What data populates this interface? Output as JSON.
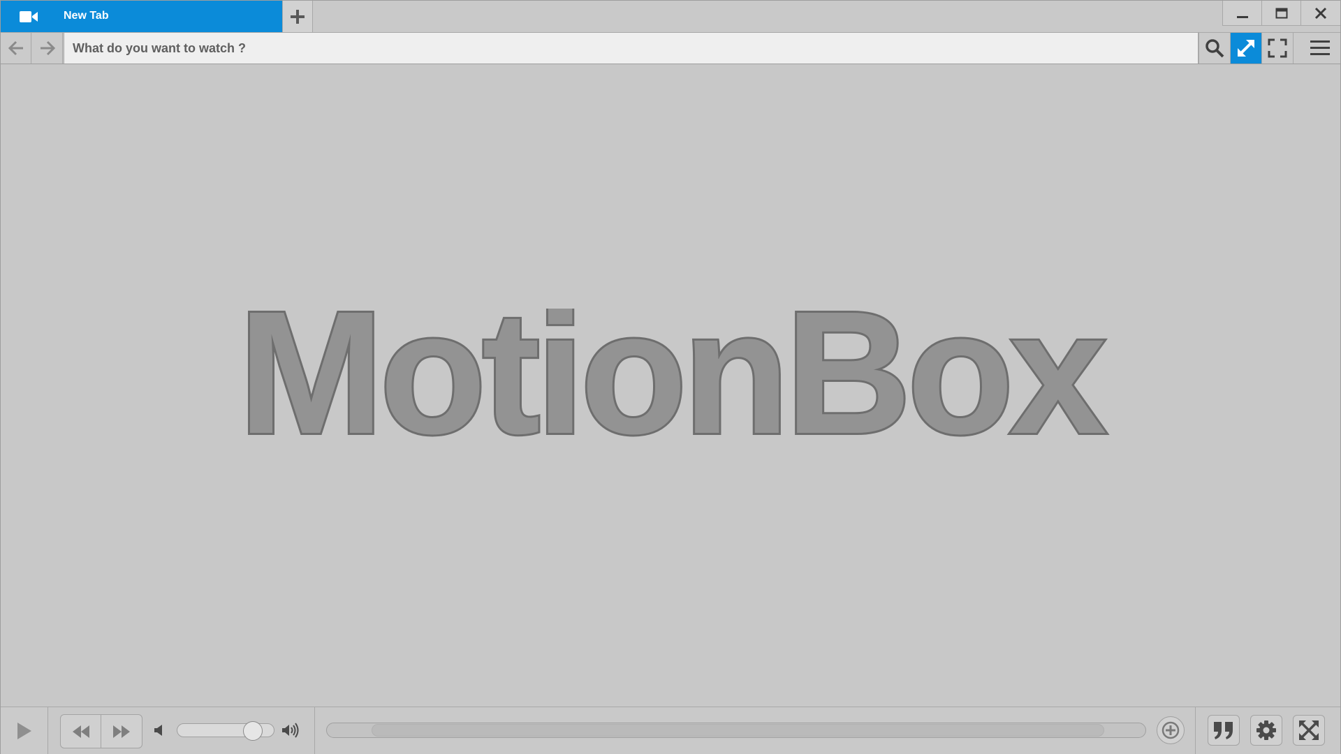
{
  "app": {
    "name": "MotionBox",
    "accent_color": "#0b8bd9"
  },
  "tabs": [
    {
      "label": "New Tab",
      "icon": "video-camera-icon",
      "active": true
    }
  ],
  "window_controls": [
    "minimize-icon",
    "maximize-icon",
    "close-icon"
  ],
  "address_bar": {
    "placeholder": "What do you want to watch ?",
    "value": "",
    "buttons": [
      "search-icon",
      "expand-icon",
      "fullscreen-corners-icon",
      "hamburger-menu-icon"
    ]
  },
  "main": {
    "logo_text": "MotionBox"
  },
  "player": {
    "volume_level": 0.85,
    "progress": 0,
    "buffered_range": [
      0.055,
      0.95
    ],
    "buttons": [
      "play-icon",
      "rewind-icon",
      "fast-forward-icon",
      "volume-low-icon",
      "volume-high-icon",
      "add-icon",
      "quote-icon",
      "gear-icon",
      "fullscreen-arrows-icon"
    ]
  }
}
